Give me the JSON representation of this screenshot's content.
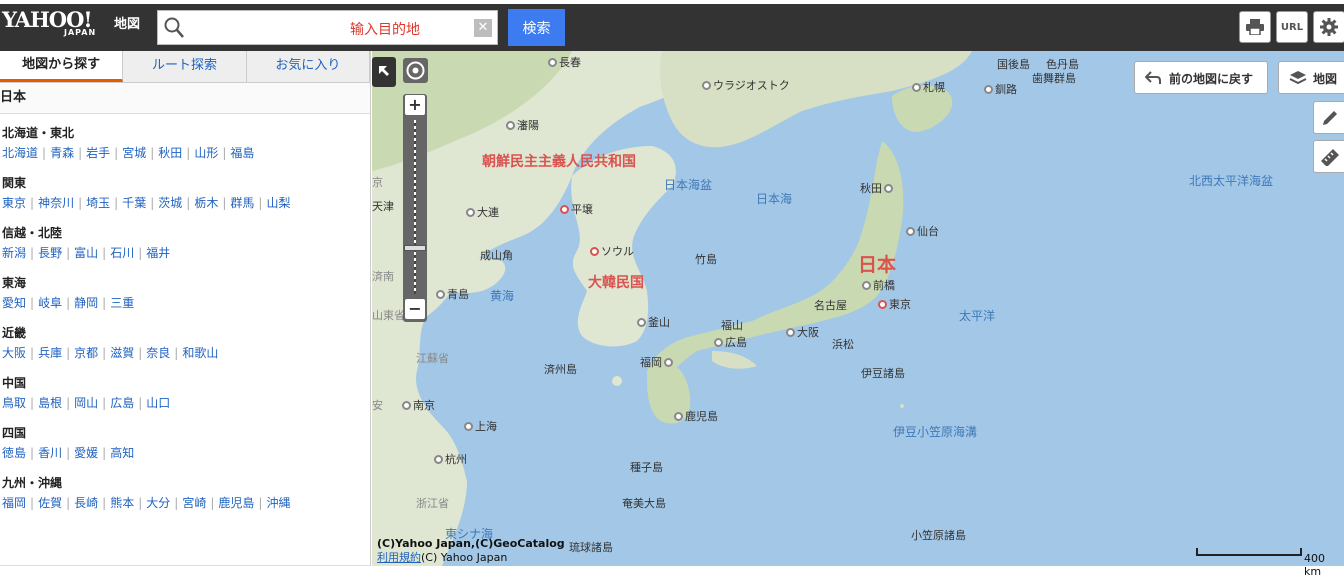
{
  "header": {
    "logo_brand": "YAHOO!",
    "logo_sub": "JAPAN",
    "service_name": "地図",
    "search_value": "",
    "search_hint": "输入目的地",
    "search_button": "検索",
    "url_button": "URL",
    "icons": [
      "search-icon",
      "clear-icon",
      "print-icon",
      "gear-icon"
    ]
  },
  "sidebar": {
    "tabs": [
      "地図から探す",
      "ルート探索",
      "お気に入り"
    ],
    "breadcrumb": "日本",
    "regions": [
      {
        "title": "北海道・東北",
        "links": [
          "北海道",
          "青森",
          "岩手",
          "宮城",
          "秋田",
          "山形",
          "福島"
        ]
      },
      {
        "title": "関東",
        "links": [
          "東京",
          "神奈川",
          "埼玉",
          "千葉",
          "茨城",
          "栃木",
          "群馬",
          "山梨"
        ]
      },
      {
        "title": "信越・北陸",
        "links": [
          "新潟",
          "長野",
          "富山",
          "石川",
          "福井"
        ]
      },
      {
        "title": "東海",
        "links": [
          "愛知",
          "岐阜",
          "静岡",
          "三重"
        ]
      },
      {
        "title": "近畿",
        "links": [
          "大阪",
          "兵庫",
          "京都",
          "滋賀",
          "奈良",
          "和歌山"
        ]
      },
      {
        "title": "中国",
        "links": [
          "鳥取",
          "島根",
          "岡山",
          "広島",
          "山口"
        ]
      },
      {
        "title": "四国",
        "links": [
          "徳島",
          "香川",
          "愛媛",
          "高知"
        ]
      },
      {
        "title": "九州・沖縄",
        "links": [
          "福岡",
          "佐賀",
          "長崎",
          "熊本",
          "大分",
          "宮崎",
          "鹿児島",
          "沖縄"
        ]
      }
    ]
  },
  "map": {
    "back_button": "前の地図に戻す",
    "layer_button": "地図",
    "zoom_in": "+",
    "zoom_out": "−",
    "cities": [
      "長春",
      "ウラジオストク",
      "札幌",
      "釧路",
      "瀋陽",
      "秋田",
      "平壌",
      "大連",
      "ソウル",
      "仙台",
      "天津",
      "成山角",
      "竹島",
      "前橋",
      "東京",
      "名古屋",
      "青島",
      "釜山",
      "福山",
      "大阪",
      "広島",
      "浜松",
      "福岡",
      "済州島",
      "伊豆諸島",
      "南京",
      "上海",
      "鹿児島",
      "杭州",
      "種子島",
      "奄美大島",
      "小笠原諸島",
      "琉球諸島",
      "国後島",
      "色丹島",
      "歯舞群島"
    ],
    "seas": [
      "日本海盆",
      "日本海",
      "北西太平洋海盆",
      "黄海",
      "太平洋",
      "伊豆小笠原海溝",
      "東シナ海"
    ],
    "countries": [
      "朝鮮民主主義人民共和国",
      "大韓民国",
      "日本"
    ],
    "partial_labels": [
      "京",
      "天津",
      "済南",
      "山東省",
      "江蘇省",
      "安",
      "浙江省"
    ],
    "copyright": "(C)Yahoo Japan,(C)GeoCatalog",
    "terms_link": "利用規約",
    "copyright2": "(C) Yahoo Japan",
    "scale_label": "400 km"
  }
}
